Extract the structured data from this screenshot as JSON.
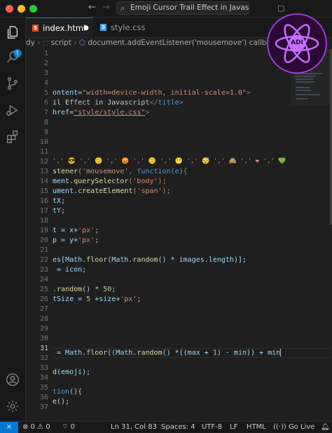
{
  "search": {
    "text": "Emoji Cursor Trail Effect in Javascript"
  },
  "activity_bar": {
    "explorer_badge": "1",
    "items": [
      "explorer-icon",
      "search-icon",
      "source-control-icon",
      "run-debug-icon",
      "extensions-icon",
      "account-icon",
      "settings-gear-icon"
    ]
  },
  "tabs": [
    {
      "label": "index.html",
      "icon": "html5-icon",
      "dirty_marker": "●"
    },
    {
      "label": "style.css",
      "icon": "css3-icon"
    }
  ],
  "breadcrumb": {
    "part1": "dy",
    "part2": "script",
    "part3": "document.addEventListener('mousemove') callback"
  },
  "logo": {
    "text": "ADI"
  },
  "editor": {
    "line_numbers": [
      "1",
      "2",
      "3",
      "4",
      "5",
      "6",
      "7",
      "8",
      "9",
      "10",
      "11",
      "12",
      "13",
      "14",
      "15",
      "16",
      "17",
      "18",
      "19",
      "20",
      "21",
      "22",
      "23",
      "24",
      "25",
      "26",
      "27",
      "28",
      "29",
      "30",
      "31",
      "32",
      "33",
      "34",
      "35",
      "36",
      "37"
    ],
    "current_line": "31",
    "lines": {
      "l5a": "ontent",
      "l5b": "=",
      "l5c": "\"width=device-width, initial-scale=1.0\"",
      "l5d": ">",
      "l6a": "il Effect in Javascript",
      "l6b": "</",
      "l6c": "title",
      "l6d": ">",
      "l7a": "href",
      "l7b": "=",
      "l7c": "\"style/style.css\"",
      "l7d": ">",
      "l12": "',' 😎 ',' 🙂 ',' 😡 ',' 🙁 ',' 😬 ',' 😴 ',' 🙈 ',' ❤ ',' 💚 ',' 💜 ',' 😈 ','",
      "l13a": "stener",
      "l13b": "('mousemove'",
      "l13c": ", function(e){",
      "l14a": "ment.",
      "l14b": "querySelector",
      "l14c": "('body');",
      "l15a": "ument.",
      "l15b": "createElement",
      "l15c": "('span');",
      "l16": "tX;",
      "l17": "tY;",
      "l19a": "t = x+",
      "l19b": "'px'",
      "l19c": ";",
      "l20a": "p = y+",
      "l20b": "'px'",
      "l20c": ";",
      "l22a": "es",
      "l22b": "[Math.",
      "l22c": "floor",
      "l22d": "(Math.",
      "l22e": "random",
      "l22f": "() * images.length)];",
      "l23": " = icon;",
      "l25a": ".",
      "l25b": "random",
      "l25c": "() * ",
      "l25d": "50",
      "l25e": ";",
      "l26a": "tSize = ",
      "l26b": "5",
      "l26c": " +size+",
      "l26d": "'px'",
      "l26e": ";",
      "l31a": " = Math.",
      "l31b": "floor",
      "l31c": "((Math.",
      "l31d": "random",
      "l31e": "() *((max + ",
      "l31f": "1",
      "l31g": ") - min)) + min",
      "l33a": "d",
      "l33b": "(emoji);",
      "l35a": "tion",
      "l35b": "(){",
      "l36a": "e",
      "l36b": "();"
    }
  },
  "status_bar": {
    "remote": "⨯",
    "errors": "0",
    "warnings": "0",
    "ports": "0",
    "position": "Ln 31, Col 83",
    "spaces": "Spaces: 4",
    "encoding": "UTF-8",
    "eol": "LF",
    "language": "HTML",
    "golive": "Go Live"
  }
}
